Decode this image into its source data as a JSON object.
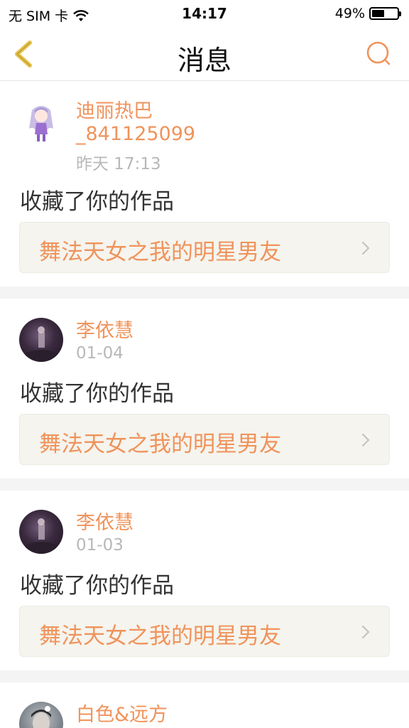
{
  "status_bar": {
    "carrier": "无 SIM 卡",
    "time": "14:17",
    "battery": "49%",
    "battery_level": 0.49
  },
  "nav": {
    "title": "消息",
    "back_icon": "chevron-left-icon",
    "search_icon": "search-icon"
  },
  "colors": {
    "accent": "#f0935b",
    "back_icon": "#e6c24a",
    "card_link_bg": "#f5f4ee",
    "divider": "#f4f4f4"
  },
  "messages": [
    {
      "user": "迪丽热巴_841125099",
      "user_line1": "迪丽热巴",
      "user_line2": "_841125099",
      "time": "昨天 17:13",
      "action": "收藏了你的作品",
      "work": "舞法天女之我的明星男友"
    },
    {
      "user": "李依慧",
      "time": "01-04",
      "action": "收藏了你的作品",
      "work": "舞法天女之我的明星男友"
    },
    {
      "user": "李依慧",
      "time": "01-03",
      "action": "收藏了你的作品",
      "work": "舞法天女之我的明星男友"
    },
    {
      "user": "白色&远方"
    }
  ]
}
